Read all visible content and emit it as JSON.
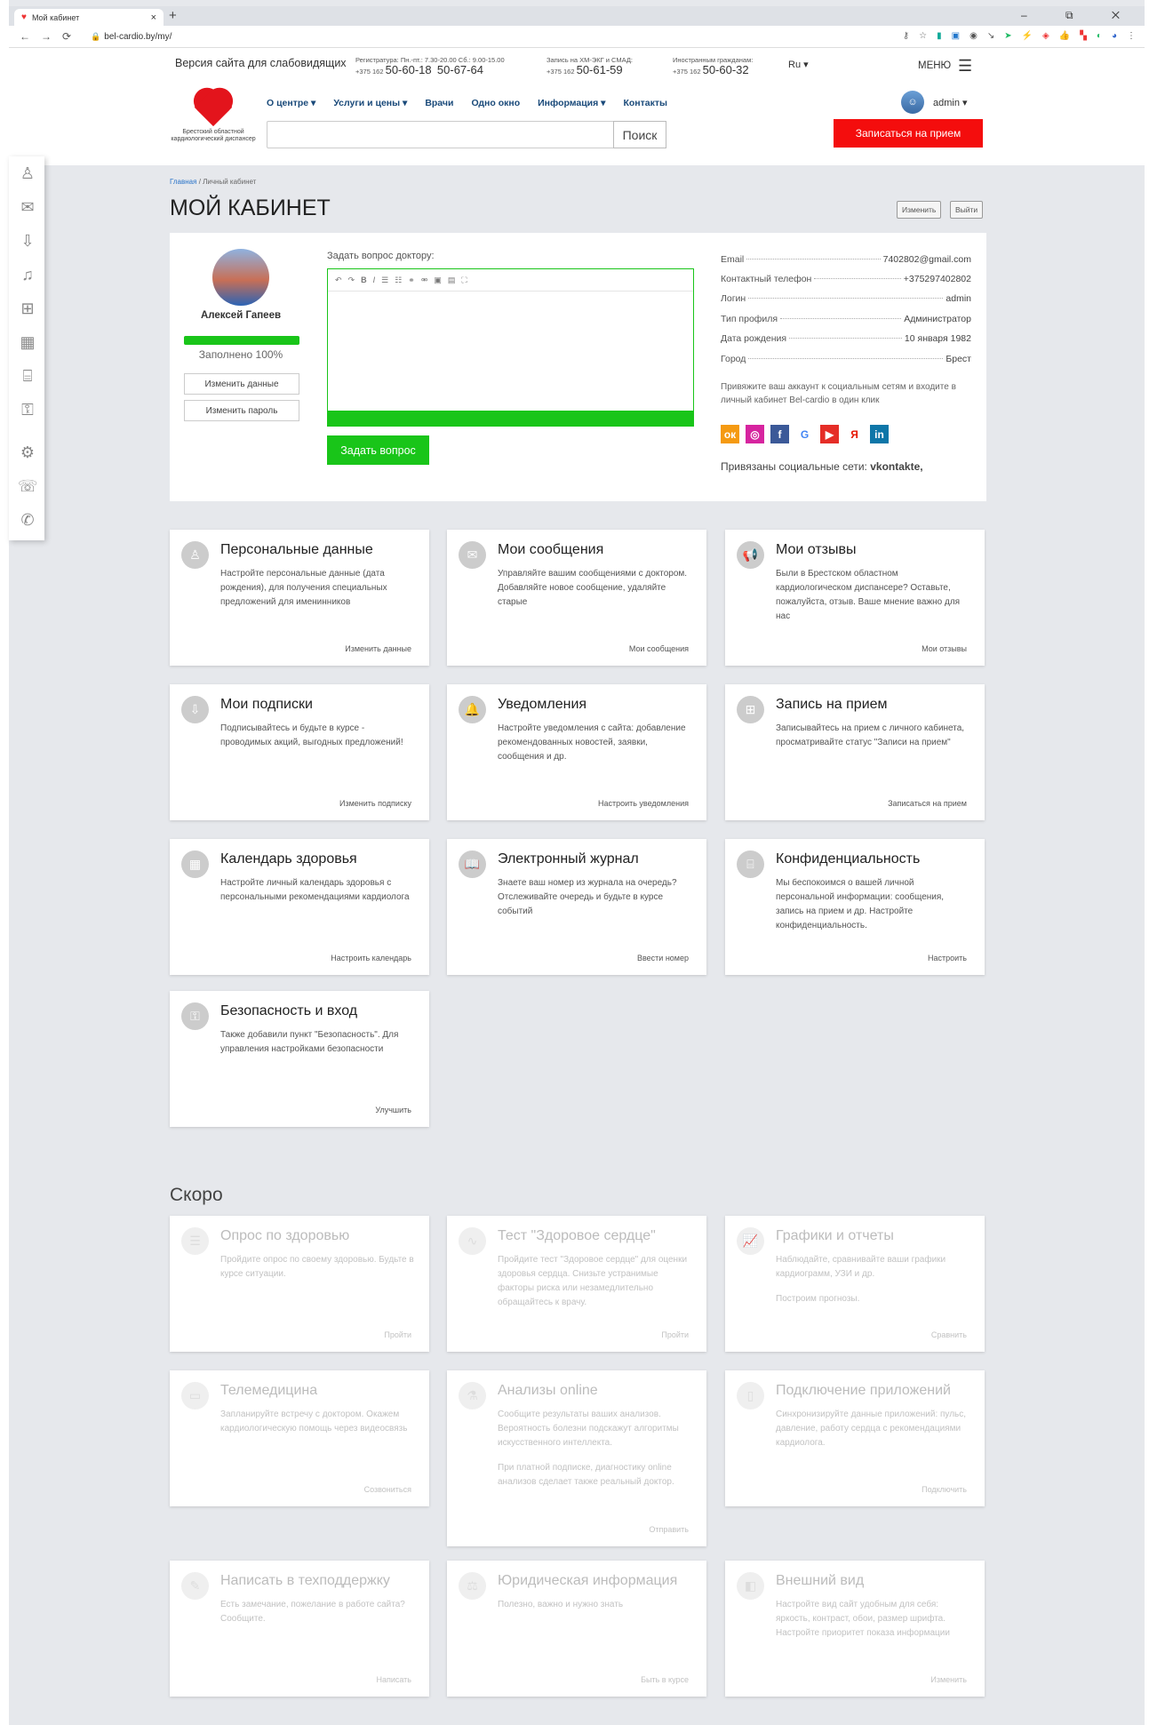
{
  "browser": {
    "tab_title": "Мой кабинет",
    "url": "bel-cardio.by/my/",
    "new_tab": "+",
    "window_controls": "–  ⧉  ✕"
  },
  "header": {
    "accessible_link": "Версия сайта для слабовидящих",
    "registry_label": "Регистратура: Пн.-пт.: 7.30-20.00 Сб.: 9.00-15.00",
    "registry_prefix": "+375 162",
    "registry_phone1": "50-60-18",
    "registry_phone2": "50-67-64",
    "ecg_label": "Запись на ХМ-ЭКГ и СМАД:",
    "ecg_prefix": "+375 162",
    "ecg_phone": "50-61-59",
    "foreign_label": "Иностранным гражданам:",
    "foreign_prefix": "+375 162",
    "foreign_phone": "50-60-32",
    "lang": "Ru ▾",
    "menu": "МЕНЮ",
    "logo_caption": "Брестский областной кардиологический диспансер",
    "nav": [
      "О центре ▾",
      "Услуги и цены ▾",
      "Врачи",
      "Одно окно",
      "Информация ▾",
      "Контакты"
    ],
    "search_button": "Поиск",
    "appointment_button": "Записаться на прием",
    "user": "admin ▾"
  },
  "breadcrumb": {
    "home": "Главная",
    "sep": "/",
    "current": "Личный кабинет"
  },
  "page_title": "МОЙ КАБИНЕТ",
  "top_buttons": {
    "edit": "Изменить",
    "logout": "Выйти"
  },
  "profile": {
    "name": "Алексей Гапеев",
    "fill_fraction": 1.0,
    "fill_text": "Заполнено 100%",
    "edit_data": "Изменить данные",
    "edit_password": "Изменить пароль",
    "question_label": "Задать вопрос доктору:",
    "ask_button": "Задать вопрос",
    "info": [
      {
        "label": "Email",
        "value": "7402802@gmail.com"
      },
      {
        "label": "Контактный телефон",
        "value": "+375297402802"
      },
      {
        "label": "Логин",
        "value": "admin"
      },
      {
        "label": "Тип профиля",
        "value": "Администратор"
      },
      {
        "label": "Дата рождения",
        "value": "10 января 1982"
      },
      {
        "label": "Город",
        "value": "Брест"
      }
    ],
    "social_note": "Привяжите ваш аккаунт к социальным сетям и входите в личный кабинет Bel-cardio в один клик",
    "social_icons": [
      {
        "name": "odnoklassniki",
        "glyph": "ок",
        "color": "#f59a12"
      },
      {
        "name": "instagram",
        "glyph": "◎",
        "color": "#d6249f"
      },
      {
        "name": "facebook",
        "glyph": "f",
        "color": "#3b5998"
      },
      {
        "name": "google",
        "glyph": "G",
        "color": "#ffffff"
      },
      {
        "name": "youtube",
        "glyph": "▶",
        "color": "#e52d27"
      },
      {
        "name": "yandex",
        "glyph": "Я",
        "color": "#ffffff"
      },
      {
        "name": "linkedin",
        "glyph": "in",
        "color": "#0e76a8"
      }
    ],
    "linked_label": "Привязаны социальные сети:",
    "linked_value": "vkontakte,"
  },
  "cards": [
    {
      "title": "Персональные данные",
      "desc": [
        "Настройте персональные данные (дата рождения), для получения специальных предложений для именинников"
      ],
      "link": "Изменить данные",
      "icon": "user-icon"
    },
    {
      "title": "Мои сообщения",
      "desc": [
        "Управляйте вашим сообщениями с доктором. Добавляйте новое сообщение, удаляйте старые"
      ],
      "link": "Мои сообщения",
      "icon": "envelope-icon"
    },
    {
      "title": "Мои отзывы",
      "desc": [
        "Были в Брестском областном кардиологическом диспансере? Оставьте, пожалуйста, отзыв. Ваше мнение важно для нас"
      ],
      "link": "Мои отзывы",
      "icon": "megaphone-icon"
    },
    {
      "title": "Мои подписки",
      "desc": [
        "Подписывайтесь и будьте в курсе - проводимых акций, выгодных предложений!"
      ],
      "link": "Изменить подписку",
      "icon": "inbox-icon"
    },
    {
      "title": "Уведомления",
      "desc": [
        "Настройте уведомления с сайта: добавление рекомендованных новостей, заявки, сообщения и др."
      ],
      "link": "Настроить уведомления",
      "icon": "bell-icon"
    },
    {
      "title": "Запись на прием",
      "desc": [
        "Записывайтесь на прием с личного кабинета, просматривайте статус \"Записи на прием\""
      ],
      "link": "Записаться на прием",
      "icon": "clipboard-icon"
    },
    {
      "title": "Календарь здоровья",
      "desc": [
        "Настройте личный календарь здоровья с персональными рекомендациями кардиолога"
      ],
      "link": "Настроить календарь",
      "icon": "calendar-icon"
    },
    {
      "title": "Электронный журнал",
      "desc": [
        "Знаете ваш номер из журнала на очередь? Отслеживайте очередь и будьте в курсе событий"
      ],
      "link": "Ввести номер",
      "icon": "journal-icon"
    },
    {
      "title": "Конфиденциальность",
      "desc": [
        "Мы беспокоимся о вашей личной персональной информации: сообщения, запись на прием и др. Настройте конфиденциальность."
      ],
      "link": "Настроить",
      "icon": "privacy-icon"
    },
    {
      "title": "Безопасность и вход",
      "desc": [
        "Также добавили пункт \"Безопасность\". Для управления настройками безопасности"
      ],
      "link": "Улучшить",
      "icon": "user-lock-icon"
    }
  ],
  "soon_title": "Скоро",
  "soon_cards": [
    {
      "title": "Опрос по здоровью",
      "desc": [
        "Пройдите опрос по своему здоровью. Будьте в курсе ситуации."
      ],
      "link": "Пройти",
      "icon": "survey-icon"
    },
    {
      "title": "Тест \"Здоровое сердце\"",
      "desc": [
        "Пройдите тест \"Здоровое сердце\" для оценки здоровья сердца. Снизьте устранимые факторы риска или незамедлительно обращайтесь к врачу."
      ],
      "link": "Пройти",
      "icon": "pulse-icon"
    },
    {
      "title": "Графики и отчеты",
      "desc": [
        "Наблюдайте, сравнивайте ваши графики кардиограмм, УЗИ и др.",
        "Построим прогнозы."
      ],
      "link": "Сравнить",
      "icon": "chart-icon"
    },
    {
      "title": "Телемедицина",
      "desc": [
        "Запланируйте встречу с доктором. Окажем кардиологическую помощь через видеосвязь"
      ],
      "link": "Созвониться",
      "icon": "monitor-icon"
    },
    {
      "title": "Анализы online",
      "desc": [
        "Сообщите результаты ваших анализов. Вероятность болезни подскажут алгоритмы искусственного интеллекта.",
        "При платной подписке, диагностику online анализов сделает также реальный доктор."
      ],
      "link": "Отправить",
      "icon": "lab-icon"
    },
    {
      "title": "Подключение приложений",
      "desc": [
        "Синхронизируйте данные приложений: пульс, давление, работу сердца с рекомендациями кардиолога."
      ],
      "link": "Подключить",
      "icon": "phone-icon"
    },
    {
      "title": "Написать в техподдержку",
      "desc": [
        "Есть замечание, пожелание в работе сайта? Сообщите."
      ],
      "link": "Написать",
      "icon": "pencil-icon"
    },
    {
      "title": "Юридическая информация",
      "desc": [
        "Полезно, важно и нужно знать"
      ],
      "link": "Быть в курсе",
      "icon": "legal-icon"
    },
    {
      "title": "Внешний вид",
      "desc": [
        "Настройте вид сайт удобным для себя: яркость, контраст, обои, размер шрифта. Настройте приоритет показа информации"
      ],
      "link": "Изменить",
      "icon": "appearance-icon"
    }
  ]
}
